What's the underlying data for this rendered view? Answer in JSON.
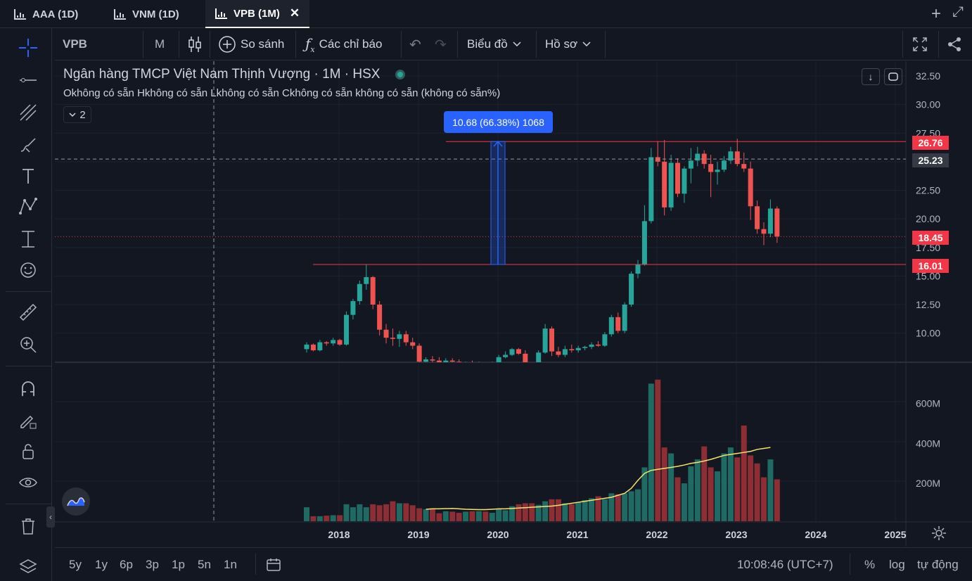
{
  "tabs": [
    {
      "label": "AAA (1D)"
    },
    {
      "label": "VNM (1D)"
    },
    {
      "label": "VPB (1M)",
      "active": true
    }
  ],
  "toolbar": {
    "symbol": "VPB",
    "interval": "M",
    "compare_label": "So sánh",
    "indicators_label": "Các chỉ báo",
    "chart_menu_label": "Biểu đồ",
    "profile_label": "Hồ sơ"
  },
  "legend": {
    "title": "Ngân hàng TMCP Việt Nam Thịnh Vượng · 1M · HSX",
    "ohlc": "Okhông có sẵn  Hkhông có sẵn  Lkhông có sẵn  Ckhông có sẵn  không có sẵn (không có sẵn%)",
    "collapsed_count": "2"
  },
  "measure_label": "10.68 (66.38%) 1068",
  "price_labels": {
    "top_line": "26.76",
    "crosshair": "25.23",
    "last": "18.45",
    "bottom_line": "16.01"
  },
  "bottombar": {
    "ranges": [
      "5y",
      "1y",
      "6p",
      "3p",
      "1p",
      "5n",
      "1n"
    ],
    "time": "10:08:46 (UTC+7)",
    "pct": "%",
    "log": "log",
    "auto": "tự động"
  },
  "colors": {
    "up": "#26a69a",
    "down": "#ef5350",
    "bg": "#131722",
    "grid": "#1e222d",
    "ma": "#f5e36b"
  },
  "chart_data": {
    "type": "candlestick",
    "price_axis": {
      "ticks": [
        "32.50",
        "30.00",
        "27.50",
        "25.00",
        "22.50",
        "20.00",
        "17.50",
        "15.00",
        "12.50",
        "10.00"
      ],
      "ylim": [
        8,
        33
      ]
    },
    "volume_axis": {
      "ticks": [
        "600M",
        "400M",
        "200M"
      ],
      "ylim": [
        0,
        800
      ]
    },
    "x_axis": {
      "ticks": [
        "2018",
        "2019",
        "2020",
        "2021",
        "2022",
        "2023",
        "2024",
        "2025"
      ]
    },
    "candles": [
      [
        8.6,
        9.2,
        8.3,
        9.0
      ],
      [
        9.0,
        9.1,
        8.4,
        8.5
      ],
      [
        8.5,
        9.4,
        8.4,
        9.2
      ],
      [
        9.2,
        9.3,
        8.9,
        9.1
      ],
      [
        9.1,
        9.6,
        8.9,
        9.4
      ],
      [
        9.4,
        9.5,
        8.9,
        9.0
      ],
      [
        9.0,
        11.9,
        8.9,
        11.6
      ],
      [
        11.6,
        13.0,
        11.2,
        12.8
      ],
      [
        12.8,
        14.6,
        12.5,
        14.3
      ],
      [
        14.3,
        16.0,
        13.8,
        14.9
      ],
      [
        14.9,
        15.0,
        12.1,
        12.5
      ],
      [
        12.5,
        12.8,
        9.8,
        10.3
      ],
      [
        10.3,
        10.8,
        9.1,
        9.6
      ],
      [
        9.6,
        10.4,
        8.9,
        9.5
      ],
      [
        9.5,
        10.2,
        8.8,
        9.9
      ],
      [
        9.9,
        10.2,
        8.9,
        9.2
      ],
      [
        9.2,
        9.6,
        8.6,
        8.9
      ],
      [
        8.9,
        9.1,
        7.0,
        7.5
      ],
      [
        7.5,
        7.9,
        6.9,
        7.7
      ],
      [
        7.7,
        8.0,
        7.3,
        7.6
      ],
      [
        7.6,
        7.9,
        7.0,
        7.2
      ],
      [
        7.2,
        7.8,
        7.1,
        7.6
      ],
      [
        7.6,
        7.8,
        7.4,
        7.5
      ],
      [
        7.5,
        7.7,
        6.8,
        7.0
      ],
      [
        7.0,
        7.5,
        6.9,
        7.3
      ],
      [
        7.3,
        7.6,
        7.1,
        7.2
      ],
      [
        7.2,
        7.5,
        6.9,
        7.3
      ],
      [
        7.3,
        7.4,
        6.9,
        7.0
      ],
      [
        7.0,
        7.5,
        6.9,
        7.4
      ],
      [
        7.4,
        8.1,
        7.3,
        7.9
      ],
      [
        7.9,
        8.4,
        7.8,
        8.1
      ],
      [
        8.1,
        8.7,
        8.0,
        8.6
      ],
      [
        8.6,
        8.7,
        8.1,
        8.2
      ],
      [
        8.2,
        8.5,
        6.9,
        7.1
      ],
      [
        7.1,
        7.3,
        6.6,
        6.9
      ],
      [
        6.9,
        8.5,
        6.8,
        8.3
      ],
      [
        8.3,
        10.8,
        8.2,
        10.4
      ],
      [
        10.4,
        10.6,
        8.0,
        8.4
      ],
      [
        8.4,
        8.8,
        7.9,
        8.1
      ],
      [
        8.1,
        8.9,
        7.9,
        8.6
      ],
      [
        8.6,
        9.0,
        8.3,
        8.5
      ],
      [
        8.5,
        8.9,
        8.3,
        8.7
      ],
      [
        8.7,
        8.9,
        8.5,
        8.8
      ],
      [
        8.8,
        9.2,
        8.6,
        9.0
      ],
      [
        9.0,
        9.3,
        8.8,
        8.9
      ],
      [
        8.9,
        10.1,
        8.8,
        9.9
      ],
      [
        9.9,
        11.6,
        9.7,
        11.4
      ],
      [
        11.4,
        11.8,
        10.0,
        10.2
      ],
      [
        10.2,
        12.7,
        10.0,
        12.5
      ],
      [
        12.5,
        15.4,
        12.3,
        15.2
      ],
      [
        15.2,
        16.4,
        14.8,
        16.0
      ],
      [
        16.0,
        21.2,
        15.9,
        19.8
      ],
      [
        19.8,
        26.2,
        19.6,
        25.4
      ],
      [
        25.4,
        26.8,
        24.6,
        25.0
      ],
      [
        25.0,
        26.9,
        20.3,
        21.0
      ],
      [
        21.0,
        25.6,
        20.7,
        24.9
      ],
      [
        24.9,
        25.3,
        21.9,
        22.2
      ],
      [
        22.2,
        24.6,
        21.4,
        24.4
      ],
      [
        24.4,
        26.2,
        23.1,
        25.1
      ],
      [
        25.1,
        26.3,
        24.6,
        25.7
      ],
      [
        25.7,
        26.0,
        24.4,
        24.8
      ],
      [
        24.8,
        25.6,
        21.9,
        24.1
      ],
      [
        24.1,
        25.0,
        23.0,
        24.3
      ],
      [
        24.3,
        25.5,
        24.1,
        25.1
      ],
      [
        25.1,
        26.3,
        24.8,
        25.9
      ],
      [
        25.9,
        27.0,
        24.6,
        24.8
      ],
      [
        24.8,
        25.8,
        24.1,
        24.4
      ],
      [
        24.4,
        25.0,
        19.9,
        21.1
      ],
      [
        21.1,
        21.6,
        18.7,
        19.1
      ],
      [
        19.1,
        19.7,
        17.7,
        18.7
      ],
      [
        18.7,
        21.7,
        18.4,
        20.9
      ],
      [
        20.9,
        21.1,
        17.9,
        18.45
      ]
    ],
    "volumes_m": [
      80,
      35,
      35,
      38,
      40,
      40,
      95,
      80,
      95,
      80,
      95,
      90,
      95,
      110,
      100,
      100,
      90,
      75,
      70,
      75,
      50,
      60,
      58,
      52,
      58,
      60,
      60,
      58,
      52,
      70,
      65,
      85,
      95,
      100,
      100,
      92,
      110,
      120,
      120,
      100,
      95,
      105,
      115,
      125,
      135,
      120,
      150,
      145,
      150,
      160,
      170,
      280,
      700,
      720,
      380,
      350,
      230,
      200,
      285,
      320,
      385,
      280,
      260,
      350,
      380,
      330,
      490,
      340,
      300,
      230,
      320,
      220
    ],
    "ma_m": [
      null,
      null,
      null,
      null,
      null,
      null,
      null,
      null,
      null,
      null,
      null,
      null,
      null,
      null,
      null,
      null,
      null,
      null,
      70,
      72,
      72,
      73,
      74,
      72,
      70,
      69,
      68,
      68,
      70,
      72,
      72,
      74,
      76,
      78,
      80,
      82,
      84,
      86,
      90,
      95,
      100,
      105,
      110,
      115,
      120,
      125,
      130,
      140,
      150,
      175,
      215,
      250,
      265,
      270,
      275,
      280,
      285,
      292,
      300,
      305,
      312,
      320,
      330,
      340,
      345,
      350,
      355,
      360,
      370,
      375,
      380
    ],
    "annotations": {
      "hline_top": 26.76,
      "hline_bottom": 16.01,
      "crosshair_price": 25.23,
      "last_price": 18.45,
      "measure": {
        "from": 16.01,
        "to": 26.76,
        "label": "10.68 (66.38%) 1068"
      }
    }
  }
}
